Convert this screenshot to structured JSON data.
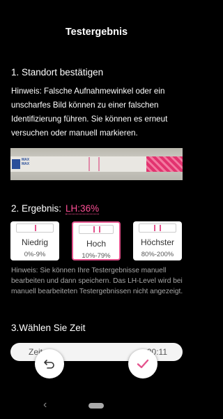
{
  "header": {
    "title": "Testergebnis"
  },
  "step1": {
    "heading": "1. Standort bestätigen",
    "paragraph": "Hinweis: Falsche Aufnahmewinkel oder ein unscharfes Bild können zu einer falschen Identifizierung führen. Sie können es erneut versuchen oder manuell markieren.",
    "strip_text": [
      "MAX",
      "MAX"
    ]
  },
  "step2": {
    "heading": "2. Ergebnis:",
    "result": "LH:36%",
    "options": [
      {
        "name": "Niedrig",
        "range": "0%-9%",
        "selected": false
      },
      {
        "name": "Hoch",
        "range": "10%-79%",
        "selected": true
      },
      {
        "name": "Höchster",
        "range": "80%-200%",
        "selected": false
      }
    ],
    "hint": "Hinweis: Sie können Ihre Testergebnisse manuell bearbeiten und dann speichern. Das LH-Level wird bei manuell bearbeiteten Testergebnissen nicht angezeigt."
  },
  "step3": {
    "heading": "3.Wählen Sie Zeit",
    "time_label": "Zeit",
    "time_value": "20:11"
  },
  "colors": {
    "accent": "#e4538d",
    "result": "#ff4f96",
    "background": "#000000"
  },
  "icons": {
    "undo": "undo-arrow-icon",
    "confirm": "checkmark-icon",
    "nav_back": "chevron-left-icon"
  }
}
